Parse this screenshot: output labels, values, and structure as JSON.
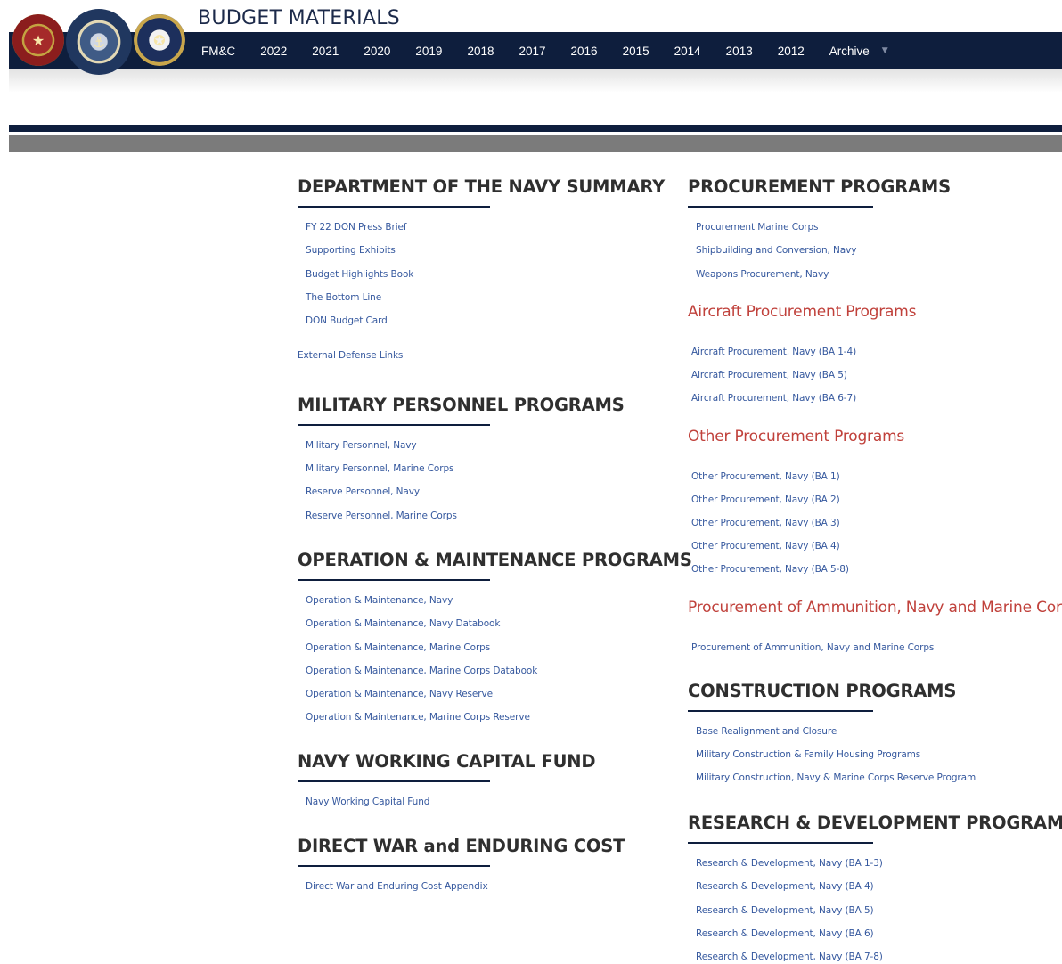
{
  "header": {
    "title": "BUDGET MATERIALS",
    "nav": [
      "FM&C",
      "2022",
      "2021",
      "2020",
      "2019",
      "2018",
      "2017",
      "2016",
      "2015",
      "2014",
      "2013",
      "2012",
      "Archive"
    ],
    "nav_caret": "▼",
    "seals": [
      "marine-corps-seal",
      "department-of-the-navy-seal",
      "navy-seal"
    ]
  },
  "colors": {
    "navy": "#0e1e3d",
    "grey_band": "#7b7b7b",
    "heading": "#2f2f2f",
    "subheading": "#c0413b",
    "link": "#35589e"
  },
  "left": {
    "don_summary": {
      "title": "DEPARTMENT OF THE NAVY SUMMARY",
      "links": [
        "FY 22 DON Press Brief",
        "Supporting Exhibits",
        "Budget Highlights Book",
        "The Bottom Line",
        "DON Budget Card"
      ],
      "extra_link": "External Defense Links"
    },
    "milpers": {
      "title": "MILITARY PERSONNEL PROGRAMS",
      "links": [
        "Military Personnel, Navy",
        "Military Personnel, Marine Corps",
        "Reserve Personnel, Navy",
        "Reserve Personnel, Marine Corps"
      ]
    },
    "om": {
      "title": "OPERATION & MAINTENANCE PROGRAMS",
      "links": [
        "Operation & Maintenance, Navy",
        "Operation & Maintenance, Navy Databook",
        "Operation & Maintenance, Marine Corps",
        "Operation & Maintenance, Marine Corps Databook",
        "Operation & Maintenance, Navy Reserve",
        "Operation & Maintenance, Marine Corps Reserve"
      ]
    },
    "nwcf": {
      "title": "NAVY WORKING CAPITAL FUND",
      "links": [
        "Navy Working Capital Fund"
      ]
    },
    "dwec": {
      "title": "DIRECT WAR and ENDURING COST",
      "links": [
        "Direct War and Enduring Cost Appendix"
      ]
    }
  },
  "right": {
    "procurement": {
      "title": "PROCUREMENT PROGRAMS",
      "links": [
        "Procurement Marine Corps",
        "Shipbuilding and Conversion, Navy",
        "Weapons Procurement, Navy"
      ]
    },
    "aircraft": {
      "title": "Aircraft Procurement Programs",
      "links": [
        "Aircraft Procurement, Navy (BA 1-4)",
        "Aircraft Procurement, Navy (BA 5)",
        "Aircraft Procurement, Navy (BA 6-7)"
      ]
    },
    "other_proc": {
      "title": "Other Procurement Programs",
      "links": [
        "Other Procurement, Navy (BA 1)",
        "Other Procurement, Navy (BA 2)",
        "Other Procurement, Navy (BA 3)",
        "Other Procurement, Navy (BA 4)",
        "Other Procurement, Navy (BA 5-8)"
      ]
    },
    "ammo": {
      "title": "Procurement of Ammunition, Navy and Marine Corps",
      "links": [
        "Procurement of Ammunition, Navy and Marine Corps"
      ]
    },
    "construction": {
      "title": "CONSTRUCTION PROGRAMS",
      "links": [
        "Base Realignment and Closure",
        "Military Construction & Family Housing Programs",
        "Military Construction, Navy & Marine Corps Reserve Program"
      ]
    },
    "rdte": {
      "title": "RESEARCH & DEVELOPMENT PROGRAM",
      "links": [
        "Research & Development, Navy (BA 1-3)",
        "Research & Development, Navy (BA 4)",
        "Research & Development, Navy (BA 5)",
        "Research & Development, Navy (BA 6)",
        "Research & Development, Navy (BA 7-8)"
      ]
    }
  }
}
